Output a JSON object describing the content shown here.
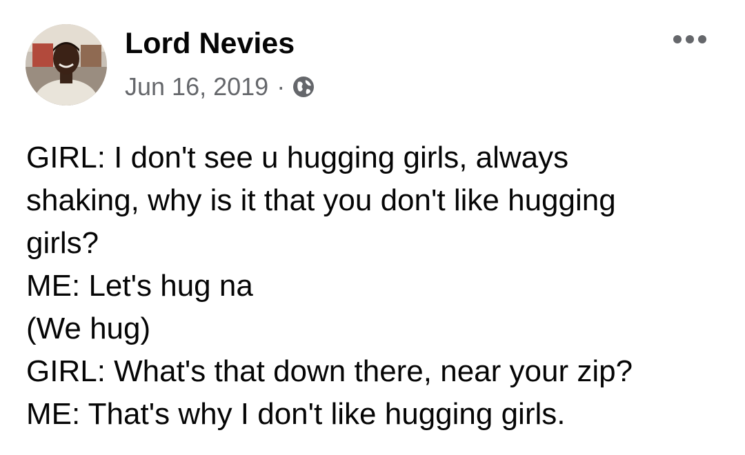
{
  "post": {
    "author": "Lord Nevies",
    "date": "Jun 16, 2019",
    "separator": "·",
    "privacy_icon": "globe-icon",
    "more_icon": "more-options-icon",
    "text_lines": [
      "GIRL: I don't see u hugging girls, always",
      "shaking, why is it that you don't like hugging",
      "girls?",
      "ME: Let's hug na",
      "(We hug)",
      "GIRL: What's that down there, near your zip?",
      "ME: That's why I don't like hugging girls."
    ]
  },
  "colors": {
    "text": "#050505",
    "meta": "#65676b",
    "background": "#ffffff"
  }
}
